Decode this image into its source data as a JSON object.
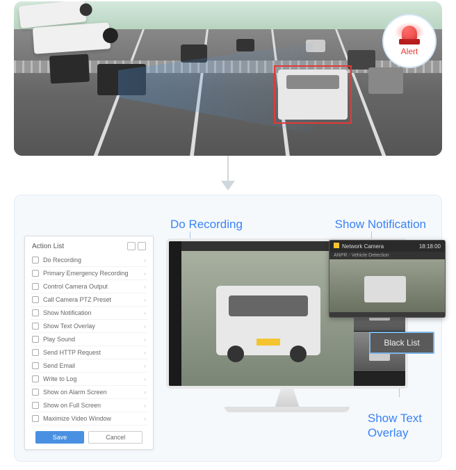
{
  "alert": {
    "label": "Alert"
  },
  "callouts": {
    "recording": "Do Recording",
    "notification": "Show Notification",
    "overlay_line1": "Show Text",
    "overlay_line2": "Overlay"
  },
  "action_list": {
    "title": "Action List",
    "items": [
      "Do Recording",
      "Primary Emergency Recording",
      "Control Camera Output",
      "Call Camera PTZ Preset",
      "Show Notification",
      "Show Text Overlay",
      "Play Sound",
      "Send HTTP Request",
      "Send Email",
      "Write to Log",
      "Show on Alarm Screen",
      "Show on Full Screen",
      "Maximize Video Window"
    ],
    "save": "Save",
    "cancel": "Cancel"
  },
  "notification": {
    "title": "Network Camera",
    "time": "18:18:00",
    "subtitle": "ANPR - Vehicle Detection"
  },
  "overlay_tag": "Black List"
}
